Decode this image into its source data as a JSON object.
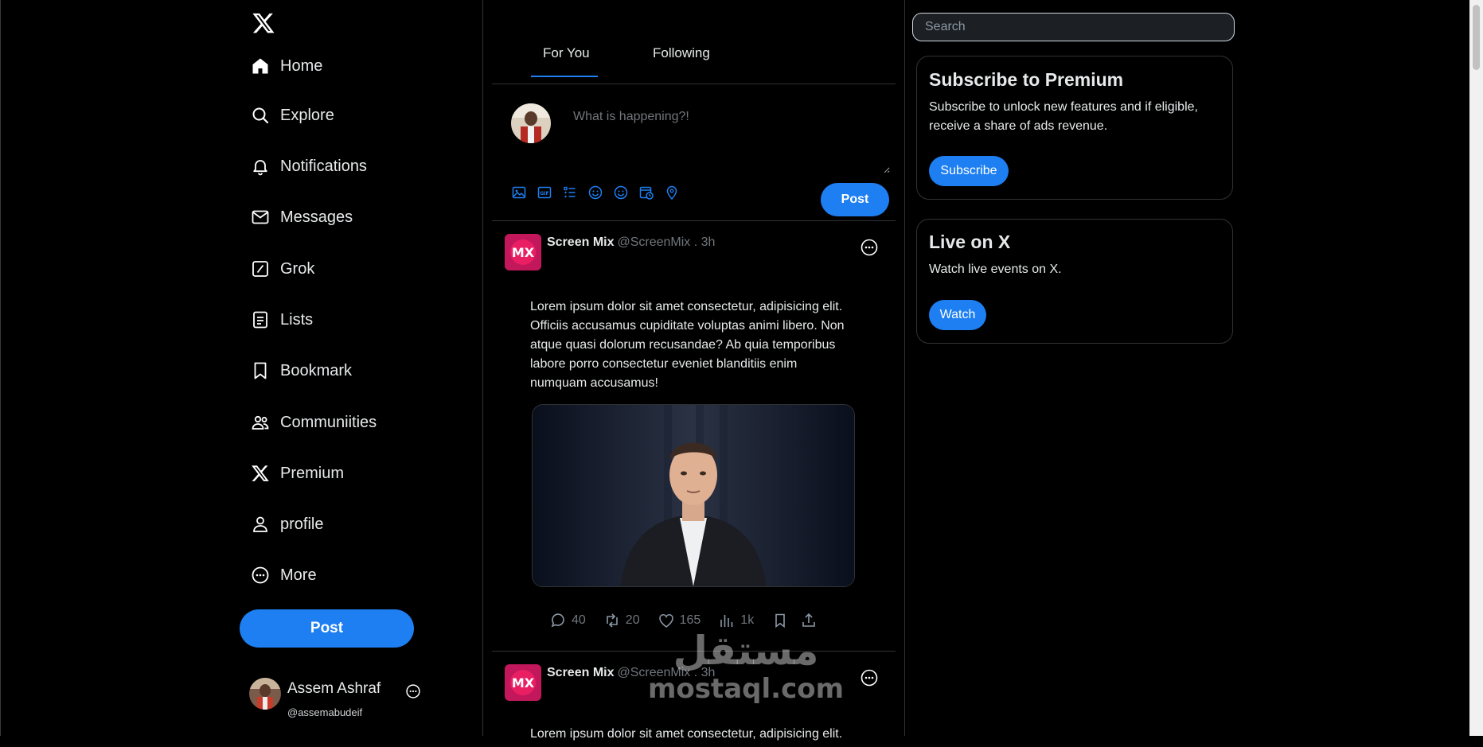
{
  "sidebar": {
    "logo_icon": "x-logo-icon",
    "nav": [
      {
        "label": "Home",
        "icon": "home-icon"
      },
      {
        "label": "Explore",
        "icon": "search-icon"
      },
      {
        "label": "Notifications",
        "icon": "bell-icon"
      },
      {
        "label": "Messages",
        "icon": "envelope-icon"
      },
      {
        "label": "Grok",
        "icon": "grok-icon"
      },
      {
        "label": "Lists",
        "icon": "list-icon"
      },
      {
        "label": "Bookmark",
        "icon": "bookmark-icon"
      },
      {
        "label": "Communiities",
        "icon": "people-icon"
      },
      {
        "label": "Premium",
        "icon": "x-logo-icon"
      },
      {
        "label": "profile",
        "icon": "person-icon"
      },
      {
        "label": "More",
        "icon": "more-circle-icon"
      }
    ],
    "post_label": "Post",
    "account": {
      "name": "Assem Ashraf",
      "handle": "@assemabudeif"
    }
  },
  "feed": {
    "tabs": [
      {
        "label": "For You",
        "active": true
      },
      {
        "label": "Following",
        "active": false
      }
    ],
    "composer": {
      "placeholder": "What is happening?!",
      "post_label": "Post",
      "tools": [
        "image-icon",
        "gif-icon",
        "poll-icon",
        "emoji-icon",
        "emoji-icon",
        "schedule-icon",
        "location-icon"
      ]
    },
    "tweets": [
      {
        "name": "Screen Mix",
        "meta": "@ScreenMix . 3h",
        "avatar_text": "MX",
        "text": "Lorem ipsum dolor sit amet consectetur, adipisicing elit. Officiis accusamus cupiditate voluptas animi libero. Non atque quasi dolorum recusandae? Ab quia temporibus labore porro consectetur eveniet blanditiis enim numquam accusamus!",
        "replies": "40",
        "retweets": "20",
        "likes": "165",
        "views": "1k"
      },
      {
        "name": "Screen Mix",
        "meta": "@ScreenMix . 3h",
        "avatar_text": "MX",
        "text": "Lorem ipsum dolor sit amet consectetur, adipisicing elit."
      }
    ]
  },
  "right": {
    "search_placeholder": "Search",
    "premium": {
      "title": "Subscribe to Premium",
      "text": "Subscribe to unlock new features and if eligible, receive a share of ads revenue.",
      "button": "Subscribe"
    },
    "live": {
      "title": "Live on X",
      "text": "Watch live events on X.",
      "button": "Watch"
    }
  },
  "watermark": {
    "arabic": "مستقل",
    "latin": "mostaql.com"
  },
  "colors": {
    "accent": "#1d7ff2",
    "background": "#000000",
    "border": "#2f3336",
    "muted": "#71767b"
  }
}
